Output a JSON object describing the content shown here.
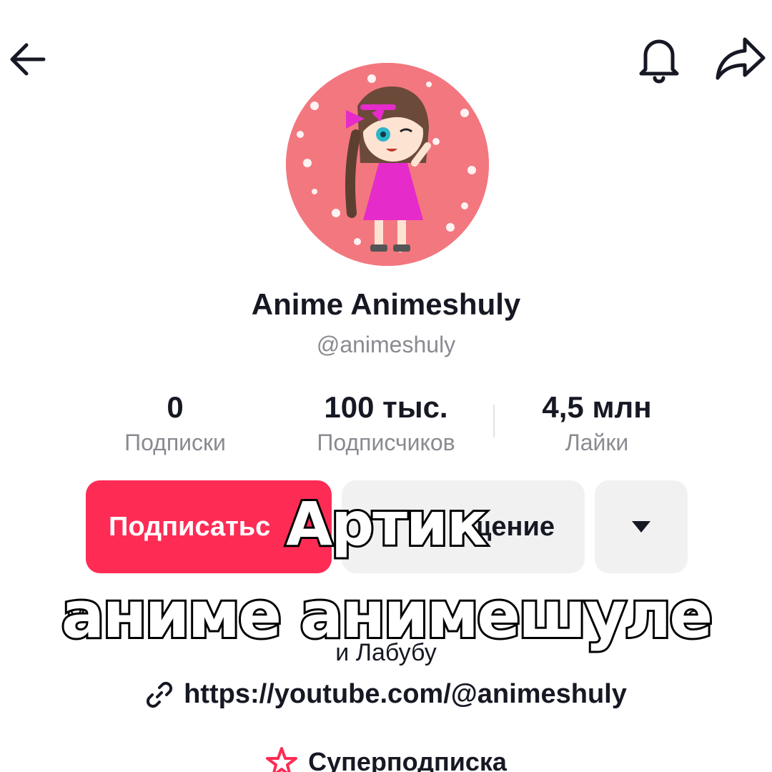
{
  "profile": {
    "display_name": "Anime Animeshuly",
    "handle": "@animeshuly",
    "bio_line1_left": "Му",
    "bio_line1_right": "ме",
    "bio_line2": "и Лабубу",
    "link": "https://youtube.com/@animeshuly",
    "super_sub": "Суперподписка"
  },
  "stats": [
    {
      "value": "0",
      "label": "Подписки"
    },
    {
      "value": "100 тыс.",
      "label": "Подписчиков"
    },
    {
      "value": "4,5 млн",
      "label": "Лайки"
    }
  ],
  "buttons": {
    "follow": "Подписатьс",
    "message": "щение"
  },
  "caption": {
    "line1": "Артик",
    "line2": "аниме анимешуле"
  },
  "colors": {
    "accent": "#fe2c55",
    "avatar_bg": "#f3777f"
  },
  "icons": [
    "back-arrow-icon",
    "bell-icon",
    "share-icon",
    "caret-down-icon",
    "link-icon",
    "star-icon"
  ]
}
